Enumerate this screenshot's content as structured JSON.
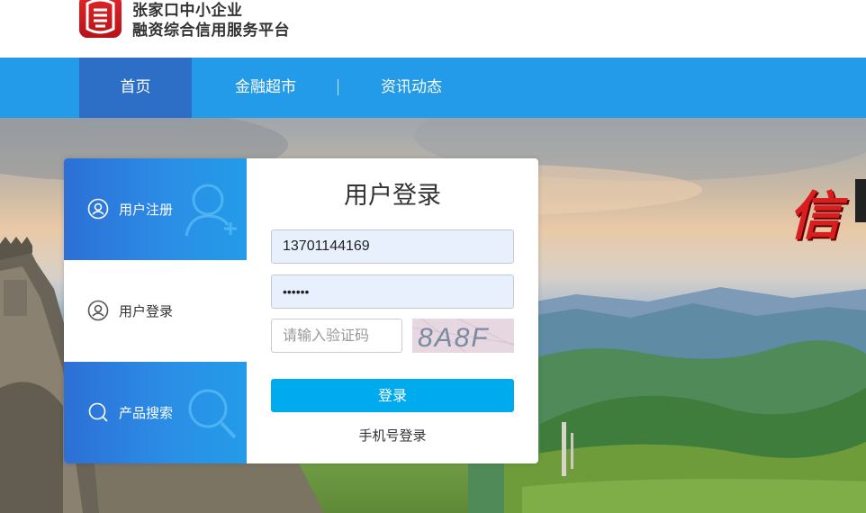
{
  "header": {
    "logo_icon": "credit-logo-icon",
    "title_line1": "张家口中小企业",
    "title_line2": "融资综合信用服务平台"
  },
  "nav": {
    "items": [
      {
        "label": "首页",
        "active": true
      },
      {
        "label": "金融超市",
        "active": false
      },
      {
        "label": "资讯动态",
        "active": false
      }
    ],
    "color": "#239be8",
    "active_color": "#2d6fc6"
  },
  "banner": {
    "slogan": "信"
  },
  "sidebar": {
    "tabs": [
      {
        "label": "用户注册",
        "icon": "user-icon"
      },
      {
        "label": "用户登录",
        "icon": "user-icon"
      },
      {
        "label": "产品搜索",
        "icon": "search-icon"
      }
    ]
  },
  "login": {
    "title": "用户登录",
    "username_value": "13701144169",
    "password_value": "••••••",
    "captcha_placeholder": "请输入验证码",
    "captcha_text": "8A8F",
    "submit_label": "登录",
    "phone_login_label": "手机号登录",
    "button_color": "#00aaee"
  }
}
